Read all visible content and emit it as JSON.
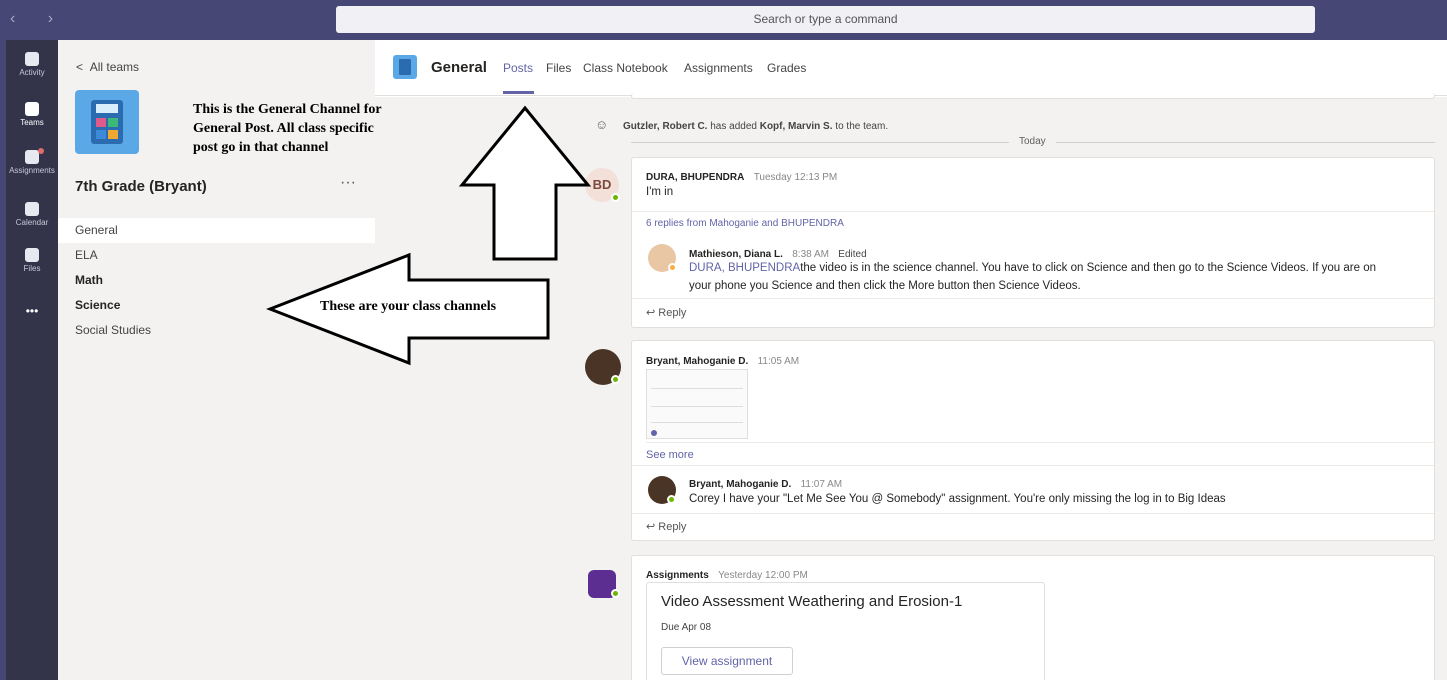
{
  "topbar": {
    "nav_arrows": "‹  ›",
    "search_placeholder": "Search or type a command",
    "bg": "#464775"
  },
  "rail": {
    "items": [
      {
        "label": "Activity",
        "icon": "bell-icon"
      },
      {
        "label": "Teams",
        "icon": "teams-icon"
      },
      {
        "label": "Assignments",
        "icon": "backpack-icon"
      },
      {
        "label": "Calendar",
        "icon": "calendar-icon"
      },
      {
        "label": "Files",
        "icon": "file-icon"
      },
      {
        "label": "•••",
        "icon": "more-icon"
      }
    ]
  },
  "team": {
    "back_label": "All teams",
    "name": "7th Grade (Bryant)",
    "more": "···",
    "channels": [
      "General",
      "ELA",
      "Math",
      "Science",
      "Social Studies"
    ]
  },
  "annotations": {
    "general": [
      "This is the General Channel for",
      "General Post.  All class specific",
      "post go in that channel"
    ],
    "channels": "These are your class channels"
  },
  "header": {
    "title": "General",
    "tabs": [
      "Posts",
      "Files",
      "Class Notebook",
      "Assignments",
      "Grades"
    ],
    "accent": "#6264a7"
  },
  "feed": {
    "system_msg": {
      "actor": "Gutzler, Robert C.",
      "middle": " has added ",
      "target": "Kopf, Marvin S.",
      "end": " to the team."
    },
    "today_label": "Today",
    "post1": {
      "initials": "BD",
      "author": "DURA, BHUPENDRA",
      "time": "Tuesday 12:13 PM",
      "text": "I'm in",
      "replies_summary": "6 replies from Mahoganie and BHUPENDRA",
      "reply_author": "Mathieson, Diana L.",
      "reply_time": "8:38 AM",
      "reply_edited": "Edited",
      "reply_mention": "DURA, BHUPENDRA",
      "reply_text_1": "the video is in the science channel. You have to click on Science and then go to the Science Videos.  If you are on",
      "reply_text_2": "your phone you Science and then click the More button then Science Videos.",
      "reply_label": "Reply"
    },
    "post2": {
      "author": "Bryant, Mahoganie D.",
      "time": "11:05 AM",
      "see_more": "See more",
      "reply_author": "Bryant, Mahoganie D.",
      "reply_time": "11:07 AM",
      "reply_text": "Corey I have your \"Let Me See You @ Somebody\" assignment. You're only missing the log in to Big Ideas",
      "reply_label": "Reply"
    },
    "post3": {
      "author": "Assignments",
      "time": "Yesterday 12:00 PM",
      "assignment_title": "Video Assessment Weathering and Erosion-1",
      "due": "Due Apr 08",
      "button": "View assignment"
    }
  }
}
